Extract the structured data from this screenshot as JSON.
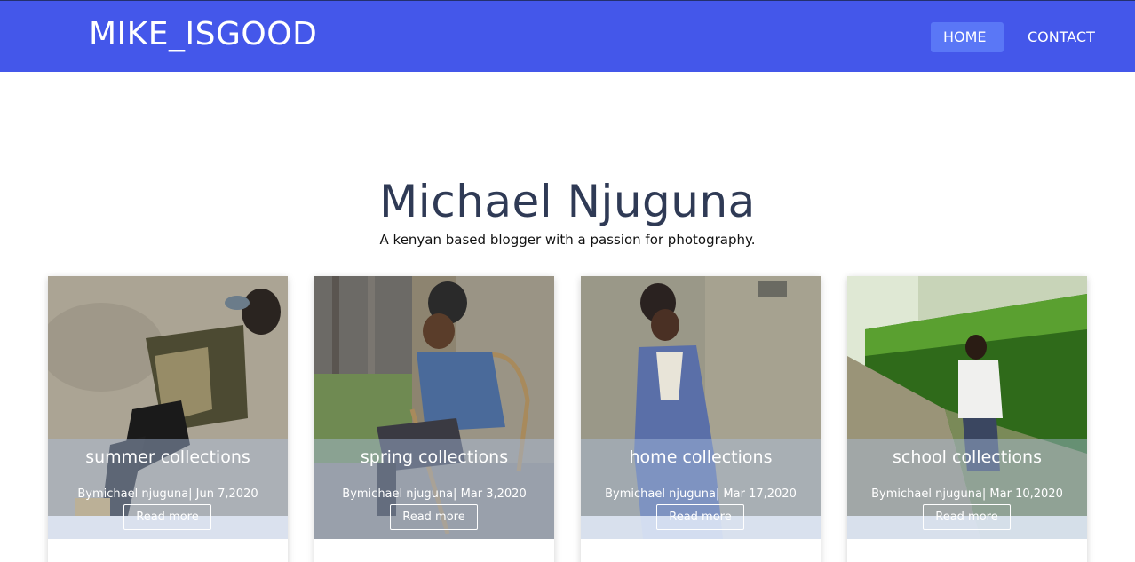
{
  "brand": "MIKE_ISGOOD",
  "nav": {
    "home": "HOME",
    "contact": "CONTACT"
  },
  "hero": {
    "title": "Michael Njuguna",
    "subtitle": "A kenyan based blogger with a passion for photography."
  },
  "colors": {
    "navbar": "#4457ea",
    "nav_active": "#5a77f6",
    "title": "#2f3a55"
  },
  "cards": [
    {
      "title": "summer collections",
      "meta": "Bymichael njuguna| Jun 7,2020",
      "button": "Read more",
      "photo_icon": "person-photo"
    },
    {
      "title": "spring collections",
      "meta": "Bymichael njuguna| Mar 3,2020",
      "button": "Read more",
      "photo_icon": "person-photo"
    },
    {
      "title": "home collections",
      "meta": "Bymichael njuguna| Mar 17,2020",
      "button": "Read more",
      "photo_icon": "person-photo"
    },
    {
      "title": "school collections",
      "meta": "Bymichael njuguna| Mar 10,2020",
      "button": "Read more",
      "photo_icon": "person-photo"
    }
  ]
}
